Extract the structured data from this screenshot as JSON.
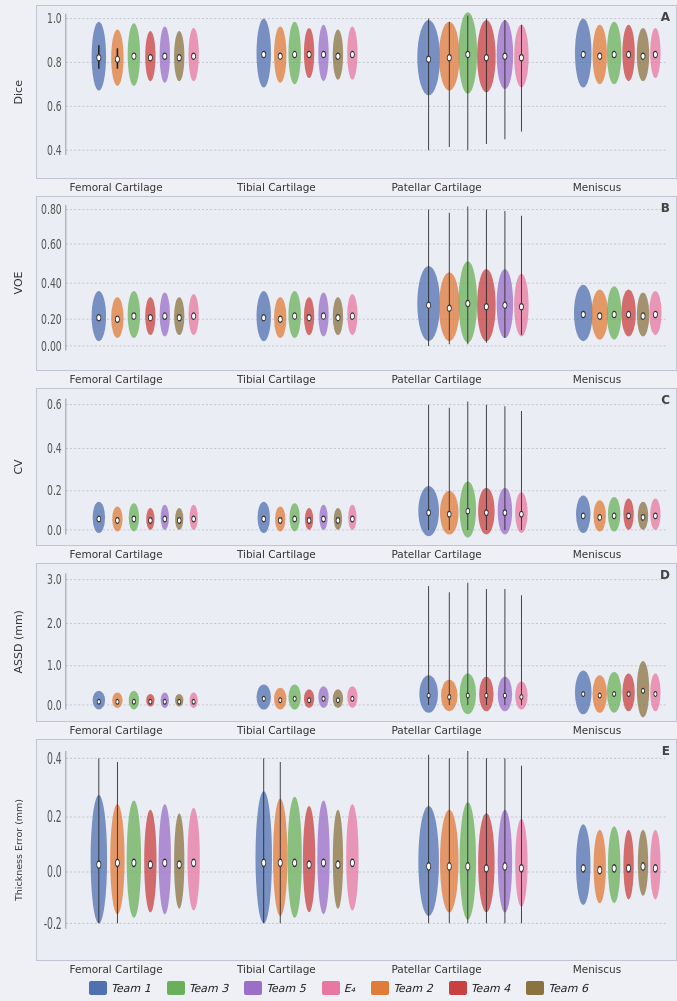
{
  "panels": [
    {
      "id": "A",
      "y_label": "Dice",
      "y_ticks": [
        "0.4",
        "0.6",
        "0.8",
        "1.0"
      ],
      "y_min": 0.35,
      "y_max": 1.02,
      "x_categories": [
        "Femoral Cartilage",
        "Tibial Cartilage",
        "Patellar Cartilage",
        "Meniscus"
      ]
    },
    {
      "id": "B",
      "y_label": "VOE",
      "y_ticks": [
        "0.00",
        "0.20",
        "0.40",
        "0.60",
        "0.80"
      ],
      "y_min": -0.05,
      "y_max": 0.85,
      "x_categories": [
        "Femoral Cartilage",
        "Tibial Cartilage",
        "Patellar Cartilage",
        "Meniscus"
      ]
    },
    {
      "id": "C",
      "y_label": "CV",
      "y_ticks": [
        "0.0",
        "0.2",
        "0.4",
        "0.6"
      ],
      "y_min": -0.03,
      "y_max": 0.65,
      "x_categories": [
        "Femoral Cartilage",
        "Tibial Cartilage",
        "Patellar Cartilage",
        "Meniscus"
      ]
    },
    {
      "id": "D",
      "y_label": "ASSD (mm)",
      "y_ticks": [
        "0.0",
        "1.0",
        "2.0",
        "3.0"
      ],
      "y_min": -0.1,
      "y_max": 3.2,
      "x_categories": [
        "Femoral Cartilage",
        "Tibial Cartilage",
        "Patellar Cartilage",
        "Meniscus"
      ]
    },
    {
      "id": "E",
      "y_label": "Thickness Error (mm)",
      "y_ticks": [
        "-0.2",
        "0.0",
        "0.2",
        "0.4"
      ],
      "y_min": -0.28,
      "y_max": 0.55,
      "x_categories": [
        "Femoral Cartilage",
        "Tibial Cartilage",
        "Patellar Cartilage",
        "Meniscus"
      ]
    }
  ],
  "legend": [
    {
      "label": "Team 1",
      "color": "#5170b0"
    },
    {
      "label": "Team 2",
      "color": "#e07b3a"
    },
    {
      "label": "Team 3",
      "color": "#6ab05a"
    },
    {
      "label": "Team 4",
      "color": "#c94040"
    },
    {
      "label": "Team 5",
      "color": "#9b6ec8"
    },
    {
      "label": "Team 6",
      "color": "#8b7340"
    },
    {
      "label": "E₄",
      "color": "#e878a0"
    }
  ],
  "colors": {
    "team1": "#5170b0",
    "team2": "#e07b3a",
    "team3": "#6ab05a",
    "team4": "#c94040",
    "team5": "#9b6ec8",
    "team6": "#8b7340",
    "e4": "#e878a0"
  }
}
